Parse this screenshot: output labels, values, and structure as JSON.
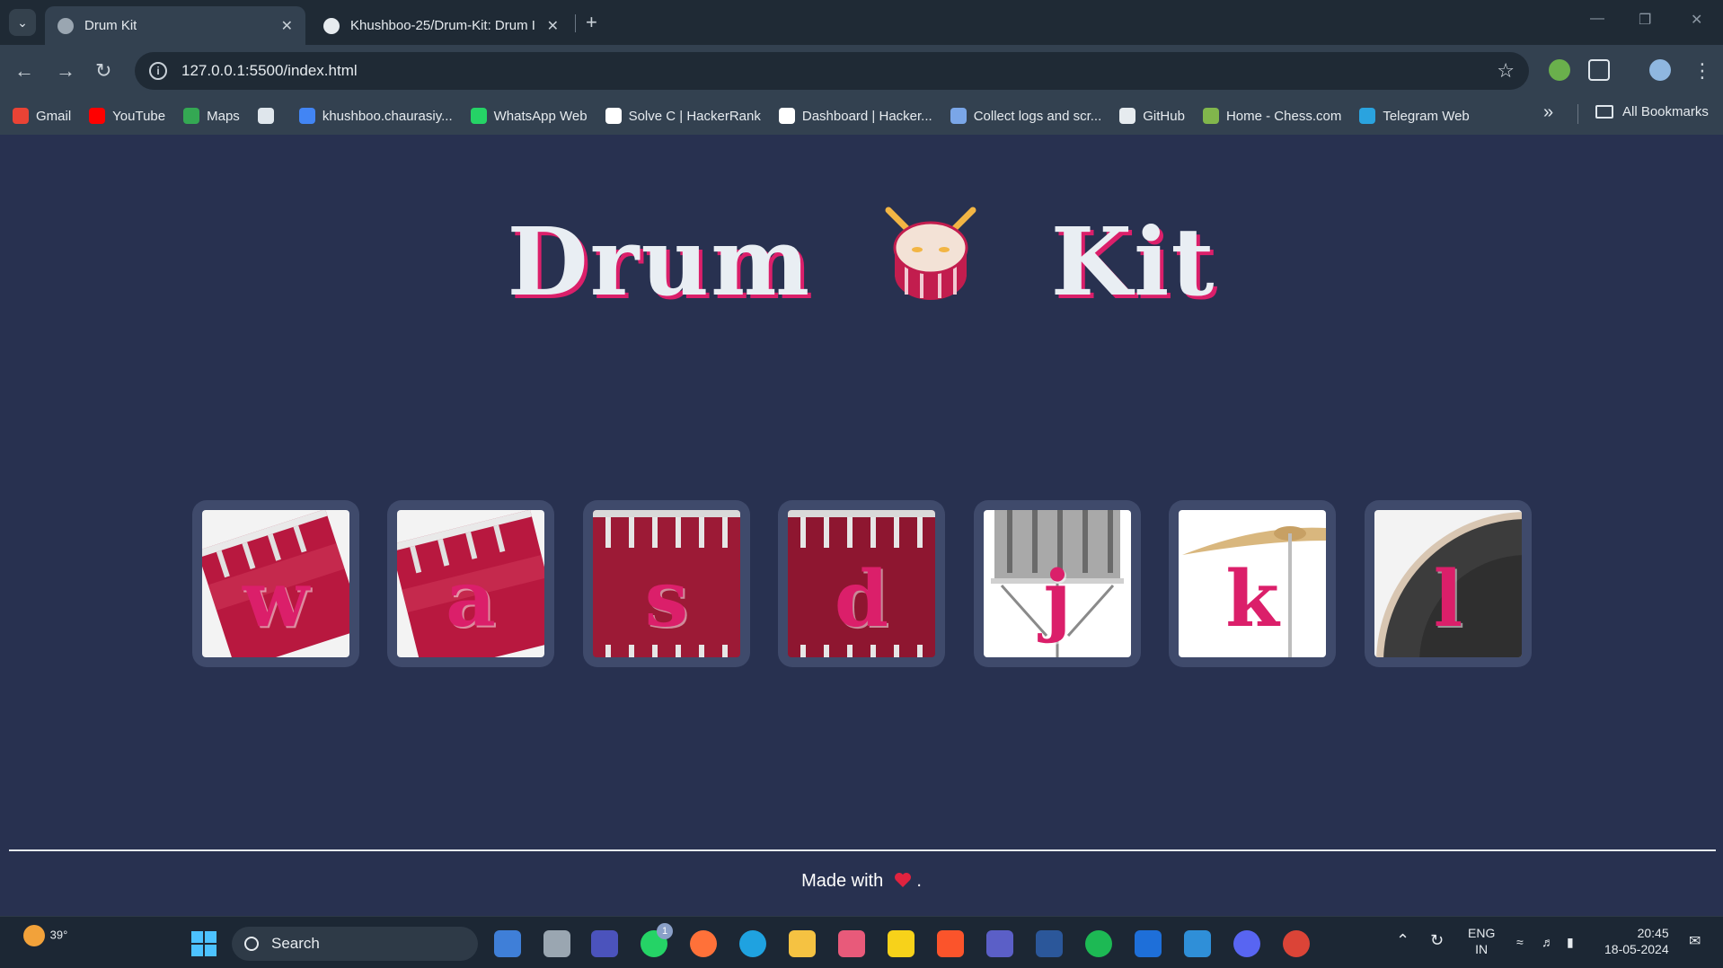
{
  "browser": {
    "tabs": [
      {
        "title": "Drum Kit",
        "active": true
      },
      {
        "title": "Khushboo-25/Drum-Kit: Drum I",
        "active": false
      }
    ],
    "url": "127.0.0.1:5500/index.html",
    "bookmarks": [
      {
        "label": "Gmail",
        "color": "#ea4335"
      },
      {
        "label": "YouTube",
        "color": "#ff0000"
      },
      {
        "label": "Maps",
        "color": "#34a853"
      },
      {
        "label": "",
        "color": "#dfe6ec"
      },
      {
        "label": "khushboo.chaurasiy...",
        "color": "#4285f4"
      },
      {
        "label": "WhatsApp Web",
        "color": "#25d366"
      },
      {
        "label": "Solve C | HackerRank",
        "color": "#ffffff"
      },
      {
        "label": "Dashboard | Hacker...",
        "color": "#ffffff"
      },
      {
        "label": "Collect logs and scr...",
        "color": "#7aa6e8"
      },
      {
        "label": "GitHub",
        "color": "#e6ebef"
      },
      {
        "label": "Home - Chess.com",
        "color": "#81b64c"
      },
      {
        "label": "Telegram Web",
        "color": "#2aa3df"
      }
    ],
    "all_bookmarks_label": "All Bookmarks"
  },
  "page": {
    "title_left": "Drum",
    "title_right": "Kit",
    "keys": [
      {
        "letter": "w",
        "drum": "tom"
      },
      {
        "letter": "a",
        "drum": "tom"
      },
      {
        "letter": "s",
        "drum": "kick"
      },
      {
        "letter": "d",
        "drum": "kick"
      },
      {
        "letter": "j",
        "drum": "snare"
      },
      {
        "letter": "k",
        "drum": "crash"
      },
      {
        "letter": "l",
        "drum": "bass"
      }
    ],
    "footer_text": "Made with",
    "footer_suffix": ".",
    "accent_color": "#db1f6a",
    "background_color": "#283150"
  },
  "taskbar": {
    "weather_temp": "39°",
    "search_label": "Search",
    "notification_badge": "1",
    "lang_line1": "ENG",
    "lang_line2": "IN",
    "time": "20:45",
    "date": "18-05-2024"
  }
}
